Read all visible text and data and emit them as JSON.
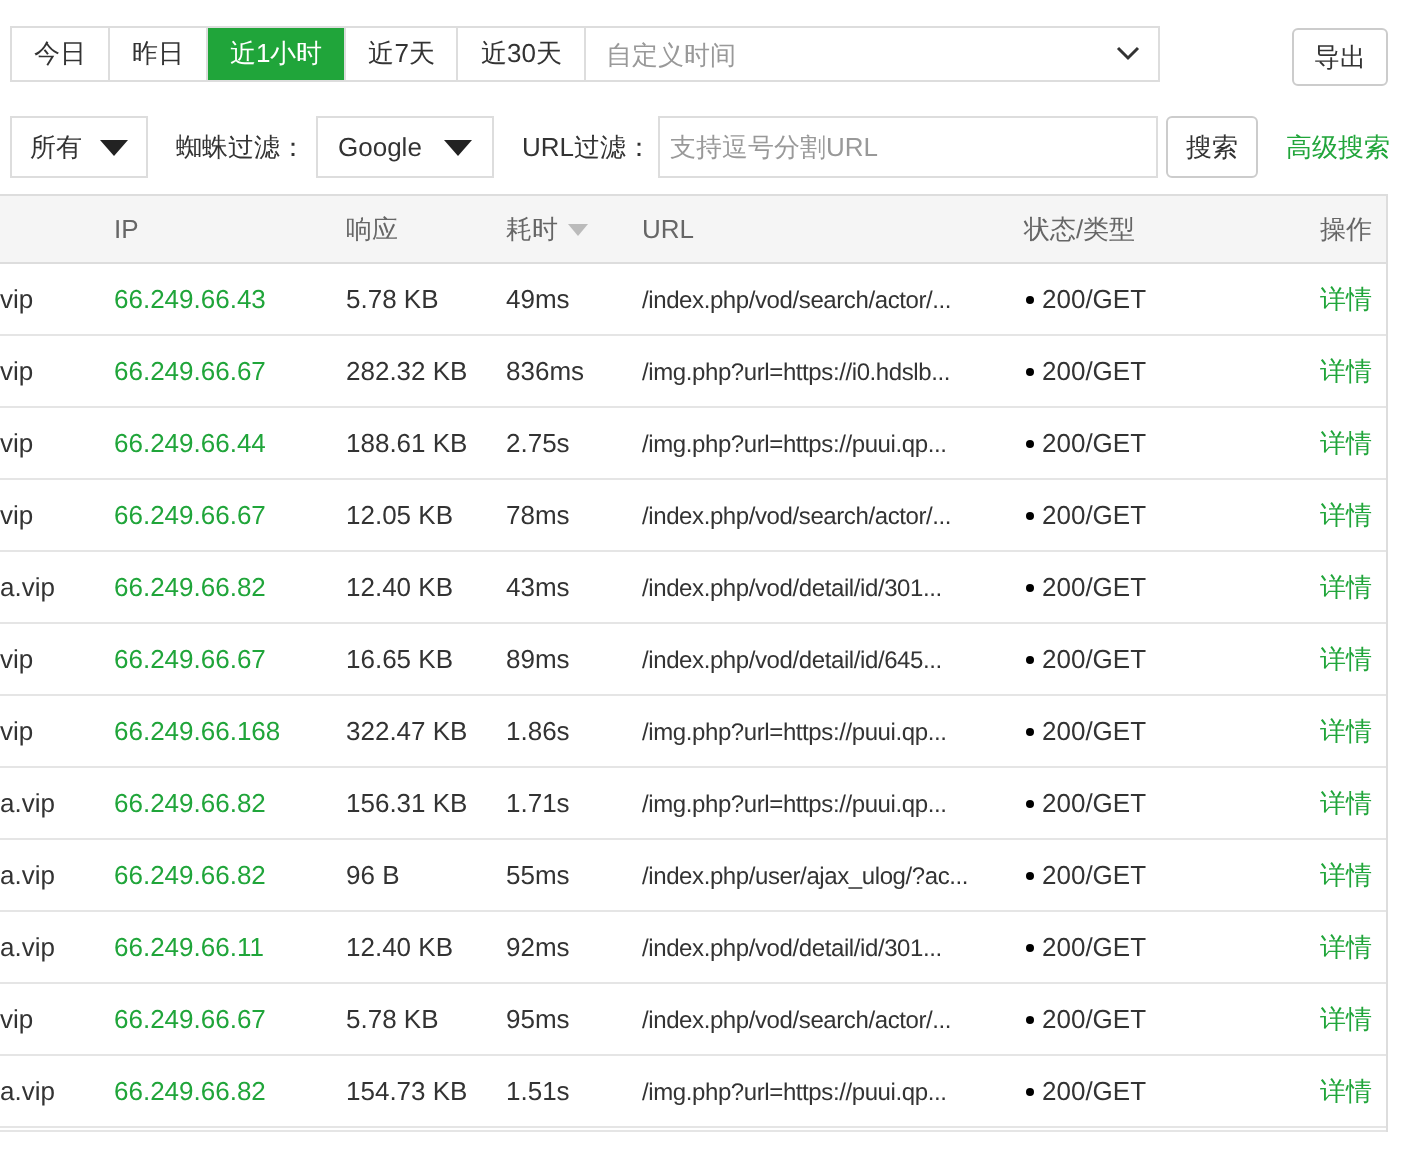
{
  "time_tabs": [
    {
      "label": "今日",
      "selected": false
    },
    {
      "label": "昨日",
      "selected": false
    },
    {
      "label": "近1小时",
      "selected": true
    },
    {
      "label": "近7天",
      "selected": false
    },
    {
      "label": "近30天",
      "selected": false
    }
  ],
  "custom_time": {
    "placeholder": "自定义时间"
  },
  "export_button": "导出",
  "filters": {
    "type_select": "所有",
    "spider_label": "蜘蛛过滤：",
    "spider_select": "Google",
    "url_label": "URL过滤：",
    "url_field": {
      "placeholder": "支持逗号分割URL"
    },
    "search_button": "搜索",
    "advanced_link": "高级搜索"
  },
  "table": {
    "columns": [
      "IP",
      "响应",
      "耗时",
      "URL",
      "状态/类型",
      "操作"
    ],
    "rows": [
      {
        "column_1": "vip",
        "ip": "66.249.66.43",
        "response": "5.78 KB",
        "time": "49ms",
        "url": "/index.php/vod/search/actor/...",
        "status": "200/GET",
        "action": "详情"
      },
      {
        "column_1": "vip",
        "ip": "66.249.66.67",
        "response": "282.32 KB",
        "time": "836ms",
        "url": "/img.php?url=https://i0.hdslb...",
        "status": "200/GET",
        "action": "详情"
      },
      {
        "column_1": "vip",
        "ip": "66.249.66.44",
        "response": "188.61 KB",
        "time": "2.75s",
        "url": "/img.php?url=https://puui.qp...",
        "status": "200/GET",
        "action": "详情"
      },
      {
        "column_1": "vip",
        "ip": "66.249.66.67",
        "response": "12.05 KB",
        "time": "78ms",
        "url": "/index.php/vod/search/actor/...",
        "status": "200/GET",
        "action": "详情"
      },
      {
        "column_1": "a.vip",
        "ip": "66.249.66.82",
        "response": "12.40 KB",
        "time": "43ms",
        "url": "/index.php/vod/detail/id/301...",
        "status": "200/GET",
        "action": "详情"
      },
      {
        "column_1": "vip",
        "ip": "66.249.66.67",
        "response": "16.65 KB",
        "time": "89ms",
        "url": "/index.php/vod/detail/id/645...",
        "status": "200/GET",
        "action": "详情"
      },
      {
        "column_1": "vip",
        "ip": "66.249.66.168",
        "response": "322.47 KB",
        "time": "1.86s",
        "url": "/img.php?url=https://puui.qp...",
        "status": "200/GET",
        "action": "详情"
      },
      {
        "column_1": "a.vip",
        "ip": "66.249.66.82",
        "response": "156.31 KB",
        "time": "1.71s",
        "url": "/img.php?url=https://puui.qp...",
        "status": "200/GET",
        "action": "详情"
      },
      {
        "column_1": "a.vip",
        "ip": "66.249.66.82",
        "response": "96 B",
        "time": "55ms",
        "url": "/index.php/user/ajax_ulog/?ac...",
        "status": "200/GET",
        "action": "详情"
      },
      {
        "column_1": "a.vip",
        "ip": "66.249.66.11",
        "response": "12.40 KB",
        "time": "92ms",
        "url": "/index.php/vod/detail/id/301...",
        "status": "200/GET",
        "action": "详情"
      },
      {
        "column_1": "vip",
        "ip": "66.249.66.67",
        "response": "5.78 KB",
        "time": "95ms",
        "url": "/index.php/vod/search/actor/...",
        "status": "200/GET",
        "action": "详情"
      },
      {
        "column_1": "a.vip",
        "ip": "66.249.66.82",
        "response": "154.73 KB",
        "time": "1.51s",
        "url": "/img.php?url=https://puui.qp...",
        "status": "200/GET",
        "action": "详情"
      }
    ]
  }
}
